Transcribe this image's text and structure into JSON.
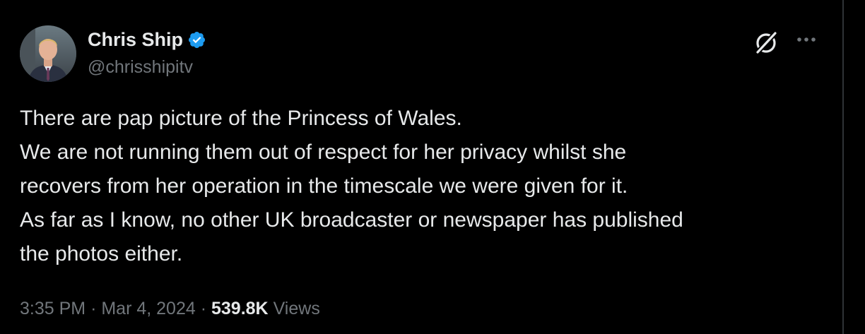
{
  "author": {
    "name": "Chris Ship",
    "handle": "@chrisshipitv",
    "verified": true
  },
  "icons": {
    "verified": "verified-badge-icon",
    "grok": "grok-icon",
    "more": "more-options-icon"
  },
  "tweet": {
    "lines": [
      "There are pap picture of the Princess of Wales.",
      "We are not running them out of respect for her privacy whilst she",
      "recovers from her operation in the timescale we were given for it.",
      "As far as I know, no other UK broadcaster or newspaper has published",
      "the photos either."
    ]
  },
  "meta": {
    "time": "3:35 PM",
    "separator": "·",
    "date": "Mar 4, 2024",
    "views_count": "539.8K",
    "views_label": "Views"
  },
  "colors": {
    "background": "#000000",
    "text_primary": "#e7e9ea",
    "text_secondary": "#71767b",
    "verified_blue": "#1d9bf0"
  }
}
